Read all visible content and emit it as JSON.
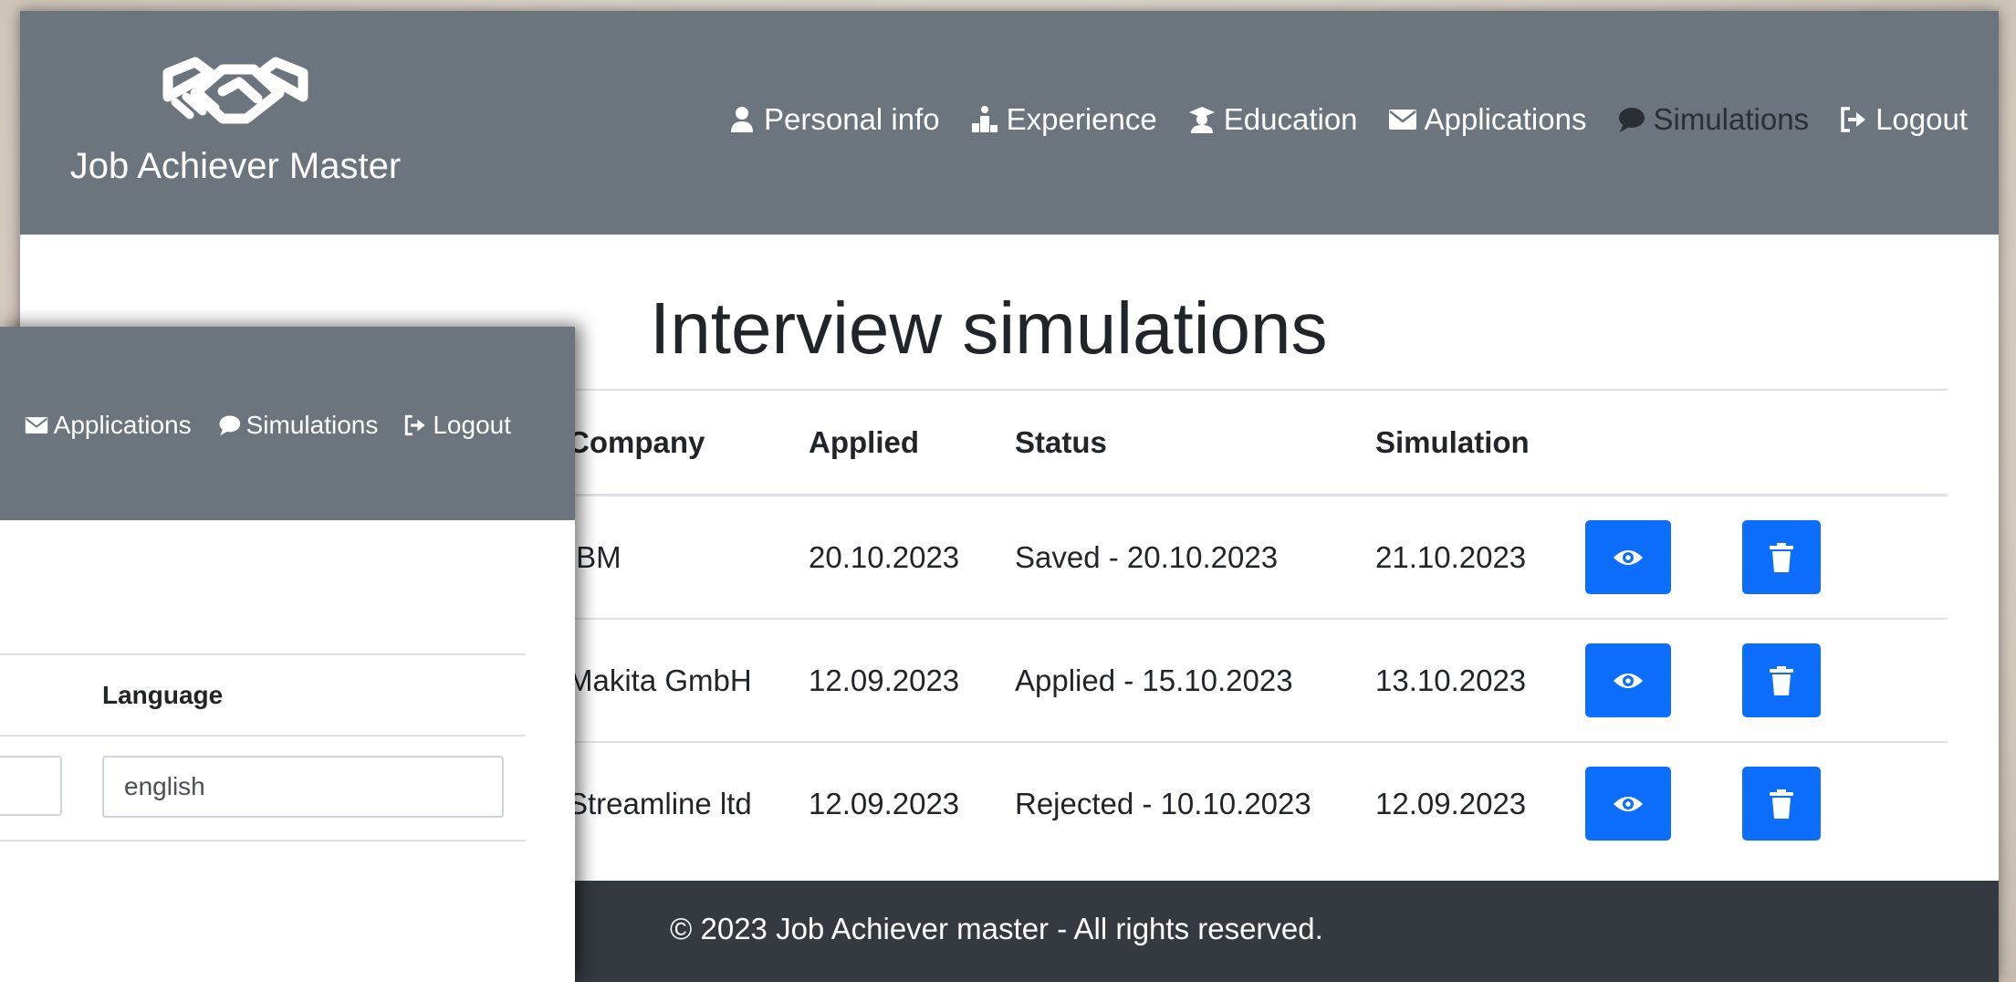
{
  "brand": {
    "name": "Job Achiever Master",
    "logo_icon": "handshake-icon"
  },
  "nav": [
    {
      "label": "Personal info",
      "icon": "person-icon",
      "active": false
    },
    {
      "label": "Experience",
      "icon": "podium-icon",
      "active": false
    },
    {
      "label": "Education",
      "icon": "graduate-icon",
      "active": false
    },
    {
      "label": "Applications",
      "icon": "envelope-icon",
      "active": false
    },
    {
      "label": "Simulations",
      "icon": "chat-icon",
      "active": true
    },
    {
      "label": "Logout",
      "icon": "logout-icon",
      "active": false
    }
  ],
  "page": {
    "title": "Interview simulations",
    "columns": [
      "Company",
      "Applied",
      "Status",
      "Simulation"
    ],
    "rows": [
      {
        "company": "IBM",
        "applied": "20.10.2023",
        "status": "Saved - 20.10.2023",
        "simulation": "21.10.2023"
      },
      {
        "company": "Makita GmbH",
        "applied": "12.09.2023",
        "status": "Applied - 15.10.2023",
        "simulation": "13.10.2023"
      },
      {
        "company": "Streamline ltd",
        "applied": "12.09.2023",
        "status": "Rejected - 10.10.2023",
        "simulation": "12.09.2023"
      }
    ],
    "row_actions": [
      {
        "icon": "eye-icon",
        "name": "view-button"
      },
      {
        "icon": "trash-icon",
        "name": "delete-button"
      }
    ]
  },
  "footer": {
    "text": "© 2023 Job Achiever master - All rights reserved."
  },
  "front_window": {
    "nav": [
      {
        "label": "Applications",
        "icon": "envelope-icon"
      },
      {
        "label": "Simulations",
        "icon": "chat-icon"
      },
      {
        "label": "Logout",
        "icon": "logout-icon"
      }
    ],
    "column_label": "Language",
    "language_value": "english"
  },
  "colors": {
    "navbar": "#6c757d",
    "active_nav_text": "#2b2f33",
    "primary_button": "#0d6efd",
    "footer": "#343a40"
  }
}
